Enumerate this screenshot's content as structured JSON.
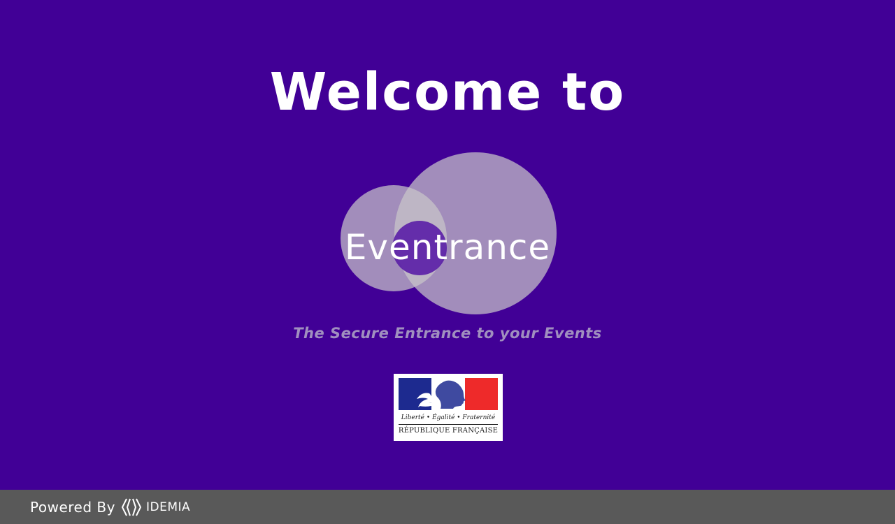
{
  "welcome": {
    "title": "Welcome to"
  },
  "logo": {
    "wordmark": "Eventrance",
    "tagline": "The Secure Entrance to your Events",
    "circle_color": "#c8c3c9",
    "overlap_color": "#5a1ea6"
  },
  "gov_logo": {
    "motto": "Liberté • Égalité • Fraternité",
    "republic": "RÉPUBLIQUE FRANÇAISE",
    "blue": "#1d2a8f",
    "red": "#ee2a2a"
  },
  "footer": {
    "powered_by": "Powered By",
    "brand": "IDEMIA"
  },
  "colors": {
    "background": "#410096",
    "footer_bg": "#595959",
    "tagline": "#a08fbf"
  }
}
